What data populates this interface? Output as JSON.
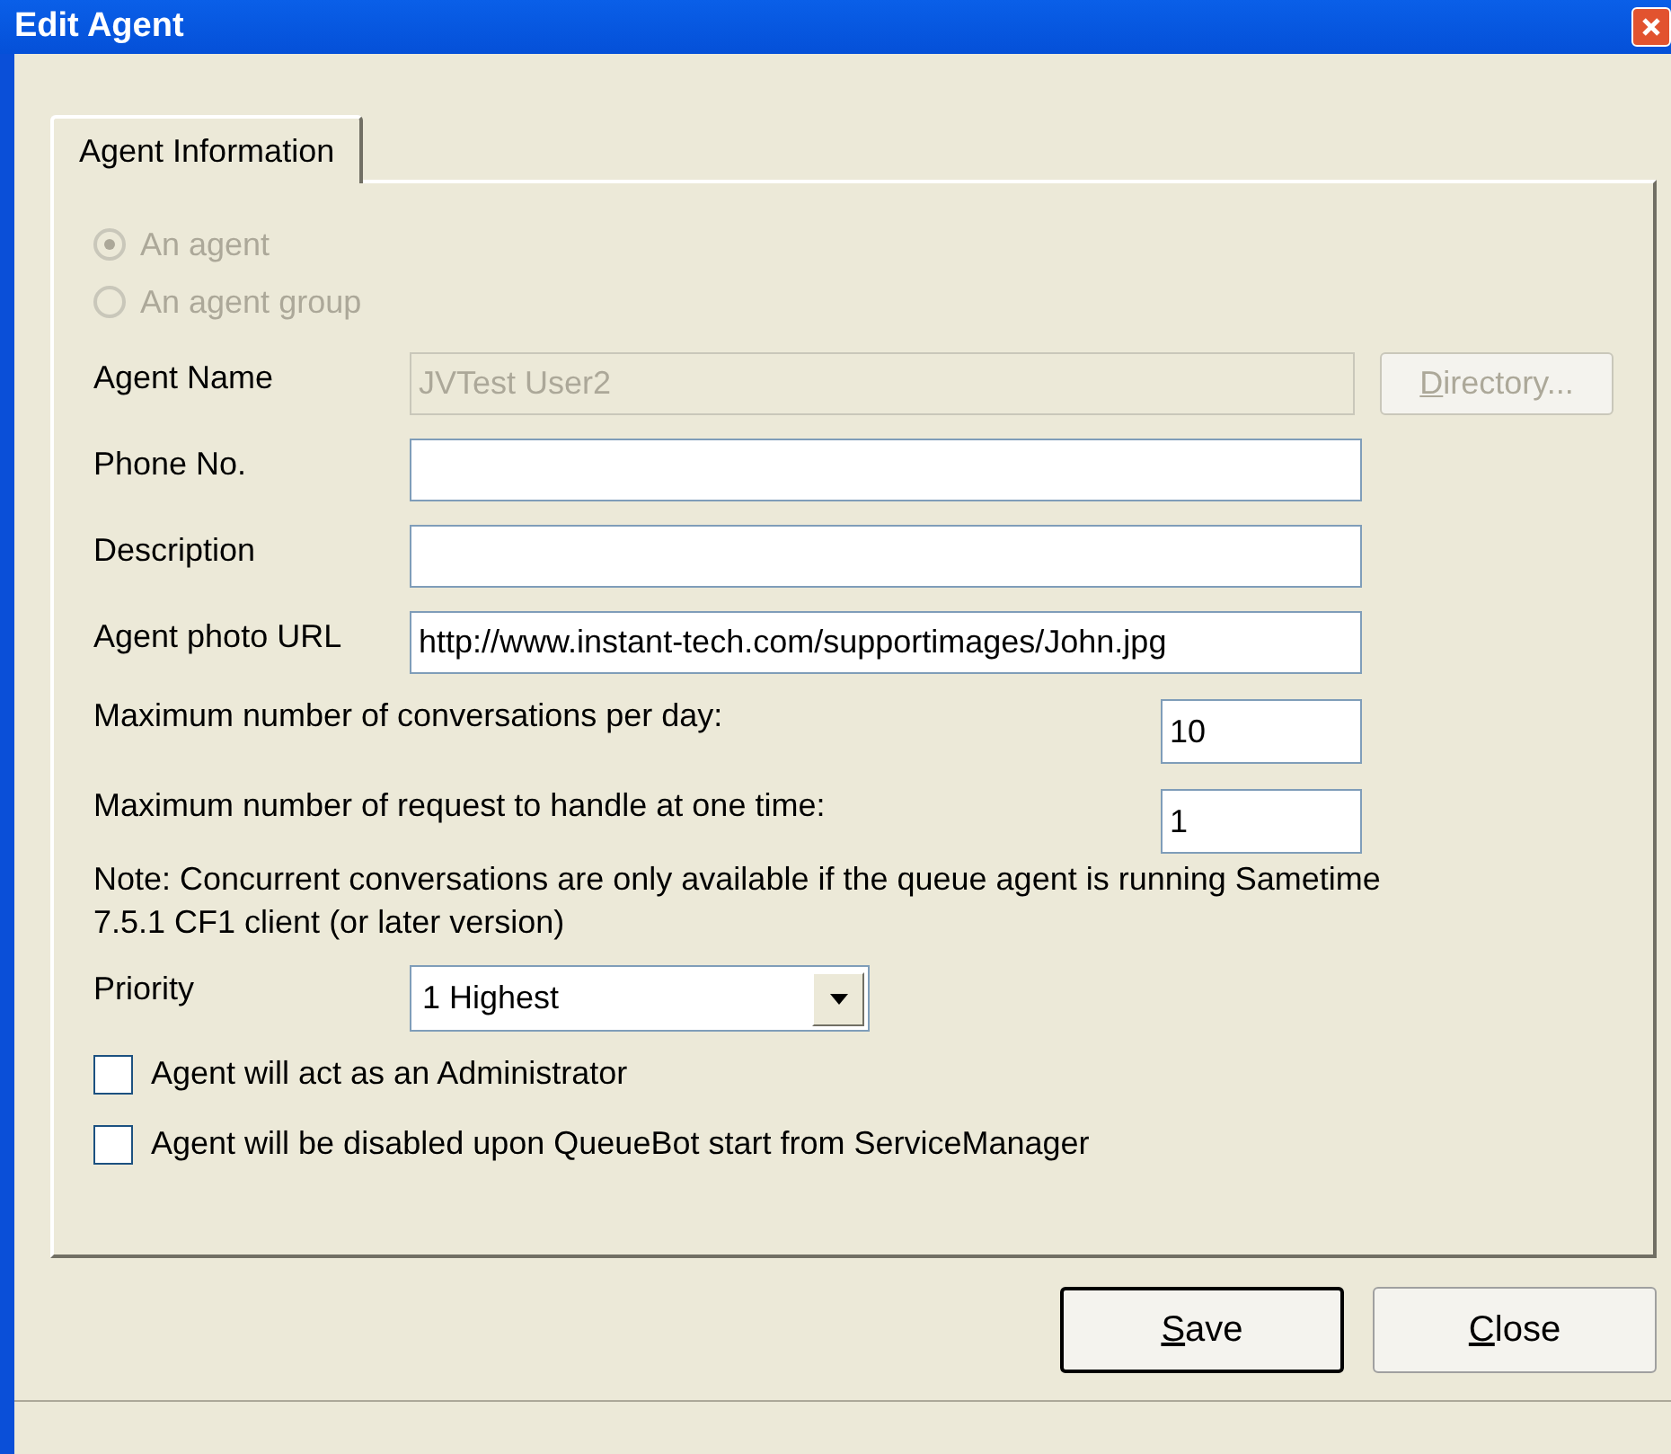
{
  "window": {
    "title": "Edit Agent"
  },
  "tabs": [
    {
      "label": "Agent Information",
      "selected": true
    }
  ],
  "agent_type": [
    {
      "label": "An agent",
      "selected": true,
      "disabled": true
    },
    {
      "label": "An agent group",
      "selected": false,
      "disabled": true
    }
  ],
  "fields": [
    {
      "label": "Agent Name",
      "value": "JVTest User2",
      "disabled": true,
      "button": {
        "label": "Directory...",
        "disabled": true
      }
    },
    {
      "label": "Phone No.",
      "disabled": false
    },
    {
      "label": "Description",
      "disabled": false
    },
    {
      "label": "Agent photo URL",
      "value": "http://www.instant-tech.com/supportimages/John.jpg",
      "disabled": false
    }
  ],
  "limits": [
    {
      "label": "Maximum number of conversations per day:",
      "value": "10"
    },
    {
      "label": "Maximum number of request to handle at one time:",
      "value": "1"
    }
  ],
  "note": "Note: Concurrent conversations are only available if the queue agent is running Sametime 7.5.1 CF1 client (or later version)",
  "priority": {
    "label": "Priority",
    "value": "1 Highest"
  },
  "options": [
    {
      "label": "Agent will act as an Administrator",
      "checked": false
    },
    {
      "label": "Agent will be disabled upon QueueBot start from ServiceManager",
      "checked": false
    }
  ],
  "buttons": [
    {
      "label": "Save",
      "default": true
    },
    {
      "label": "Close",
      "default": false
    }
  ]
}
